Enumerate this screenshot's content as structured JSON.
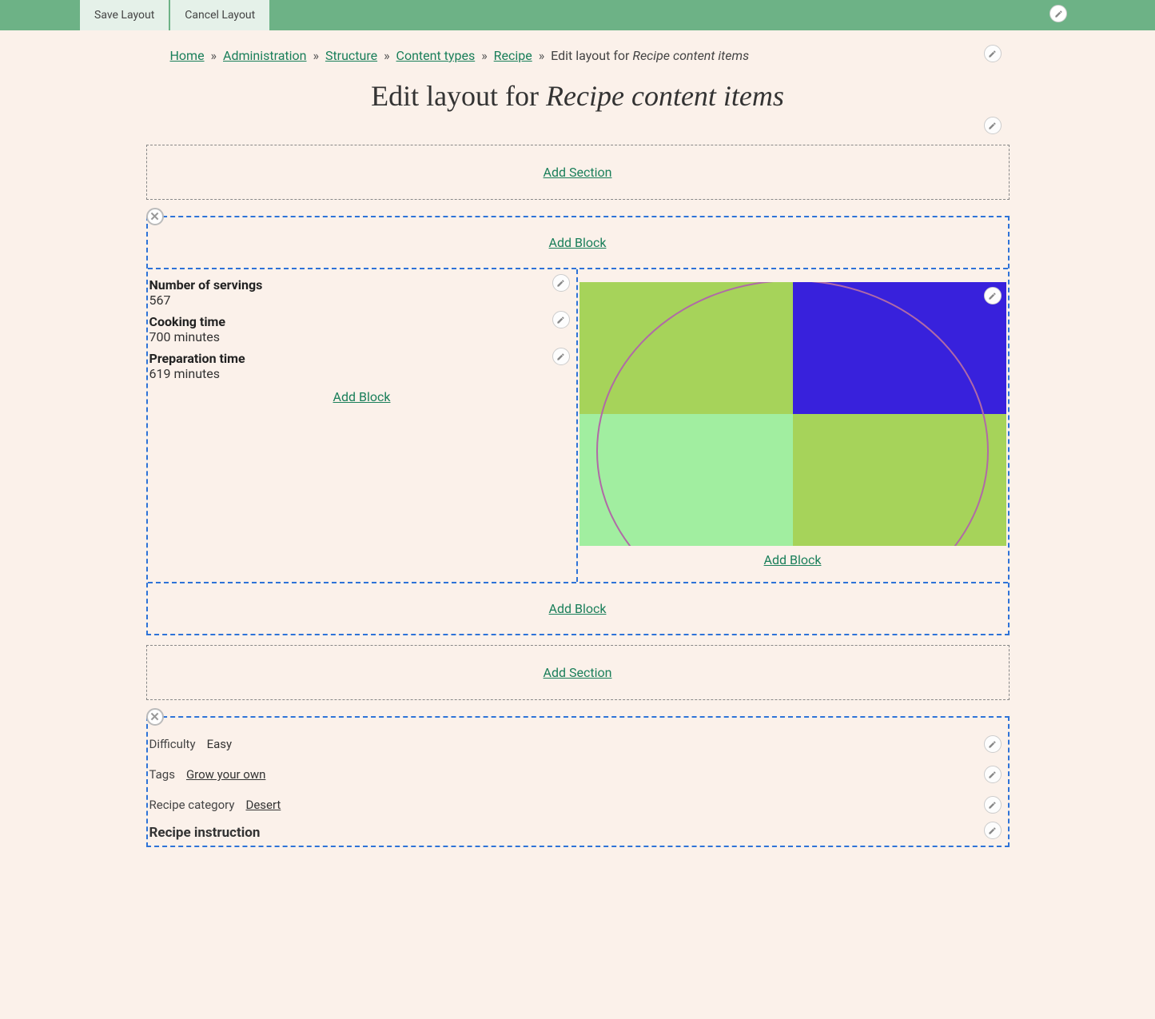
{
  "toolbar": {
    "save": "Save Layout",
    "cancel": "Cancel Layout"
  },
  "breadcrumb": {
    "items": [
      "Home",
      "Administration",
      "Structure",
      "Content types",
      "Recipe"
    ],
    "current_prefix": "Edit layout for ",
    "current_italic": "Recipe content items"
  },
  "title": {
    "prefix": "Edit layout for ",
    "italic": "Recipe content items"
  },
  "labels": {
    "add_section": "Add Section",
    "add_block": "Add Block"
  },
  "section1": {
    "left_fields": [
      {
        "label": "Number of servings",
        "value": "567"
      },
      {
        "label": "Cooking time",
        "value": "700 minutes"
      },
      {
        "label": "Preparation time",
        "value": "619 minutes"
      }
    ]
  },
  "section2": {
    "rows": [
      {
        "label": "Difficulty",
        "value": "Easy",
        "link": false
      },
      {
        "label": "Tags",
        "value": "Grow your own",
        "link": true
      },
      {
        "label": "Recipe category",
        "value": "Desert",
        "link": true
      }
    ],
    "instruction_heading": "Recipe instruction"
  }
}
